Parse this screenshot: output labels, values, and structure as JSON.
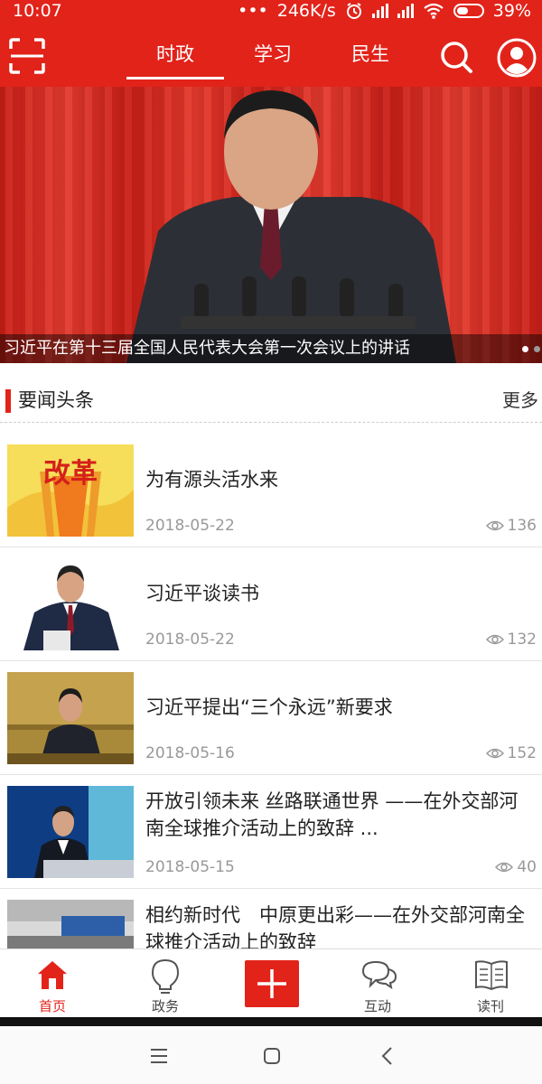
{
  "status": {
    "time": "10:07",
    "dots": "•••",
    "speed": "246K/s",
    "battery": "39%"
  },
  "header": {
    "tabs": [
      {
        "label": "时政",
        "active": true
      },
      {
        "label": "学习",
        "active": false
      },
      {
        "label": "民生",
        "active": false
      }
    ],
    "icons": [
      "scan-icon",
      "search-icon",
      "user-icon"
    ]
  },
  "banner": {
    "caption": "习近平在第十三届全国人民代表大会第一次会议上的讲话",
    "slides": 2,
    "active_slide": 1
  },
  "section": {
    "title": "要闻头条",
    "more": "更多"
  },
  "news": [
    {
      "title": "为有源头活水来",
      "date": "2018-05-22",
      "views": "136",
      "thumb_text": "改革"
    },
    {
      "title": "习近平谈读书",
      "date": "2018-05-22",
      "views": "132"
    },
    {
      "title": "习近平提出“三个永远”新要求",
      "date": "2018-05-16",
      "views": "152"
    },
    {
      "title": "开放引领未来 丝路联通世界 ——在外交部河南全球推介活动上的致辞 ...",
      "date": "2018-05-15",
      "views": "40"
    },
    {
      "title": "相约新时代　中原更出彩——在外交部河南全球推介活动上的致辞",
      "date": "",
      "views": ""
    }
  ],
  "bottom_nav": [
    {
      "label": "首页",
      "icon": "home-icon",
      "active": true
    },
    {
      "label": "政务",
      "icon": "bulb-icon",
      "active": false
    },
    {
      "label": "",
      "icon": "plus-icon",
      "active": false
    },
    {
      "label": "互动",
      "icon": "chat-icon",
      "active": false
    },
    {
      "label": "读刊",
      "icon": "book-icon",
      "active": false
    }
  ],
  "colors": {
    "brand": "#e2231a",
    "text": "#222222",
    "muted": "#999999"
  }
}
